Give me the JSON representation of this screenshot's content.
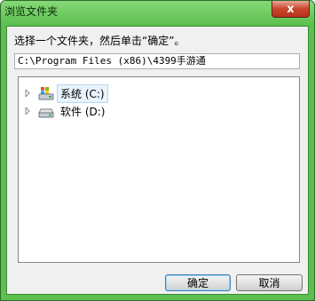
{
  "window": {
    "title": "浏览文件夹",
    "close_glyph": "x"
  },
  "dialog": {
    "instruction": "选择一个文件夹，然后单击“确定”。",
    "path_value": "C:\\Program Files (x86)\\4399手游通"
  },
  "tree": {
    "items": [
      {
        "label": "系统 (C:)",
        "icon": "windows-system-drive-icon",
        "selected": true
      },
      {
        "label": "软件 (D:)",
        "icon": "hard-drive-icon",
        "selected": false
      }
    ]
  },
  "buttons": {
    "ok": "确定",
    "cancel": "取消"
  },
  "colors": {
    "frame": "#5cbf4e",
    "close": "#c9452b",
    "selection": "#e8f3fd"
  }
}
